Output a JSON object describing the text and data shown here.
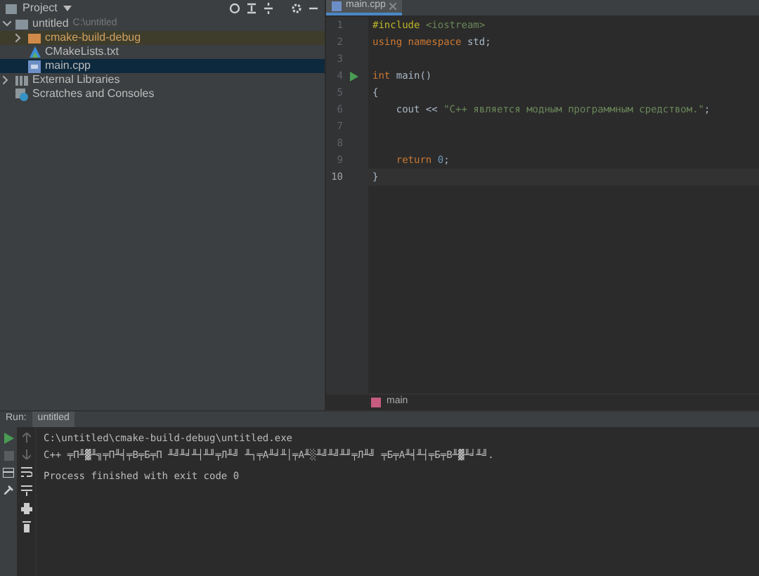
{
  "project_panel": {
    "title": "Project",
    "tree": [
      {
        "label": "untitled",
        "path": "C:\\untitled",
        "kind": "folder",
        "expanded": true,
        "selected": false,
        "children": [
          {
            "label": "cmake-build-debug",
            "kind": "excluded",
            "expanded": false,
            "selected": false
          },
          {
            "label": "CMakeLists.txt",
            "kind": "cmake",
            "selected": false
          },
          {
            "label": "main.cpp",
            "kind": "cpp",
            "selected": true
          }
        ]
      },
      {
        "label": "External Libraries",
        "kind": "libs",
        "expanded": false,
        "selected": false
      },
      {
        "label": "Scratches and Consoles",
        "kind": "scratch",
        "selected": false
      }
    ]
  },
  "editor": {
    "tabs": [
      {
        "label": "main.cpp",
        "selected": true
      }
    ],
    "lines": [
      {
        "number": "1",
        "current": false,
        "runnable": false,
        "tokens": [
          {
            "kind": "preproc",
            "text": "#include "
          },
          {
            "kind": "header",
            "text": "<iostream>"
          }
        ]
      },
      {
        "number": "2",
        "current": false,
        "runnable": false,
        "tokens": [
          {
            "kind": "keyword",
            "text": "using namespace "
          },
          {
            "kind": "plain",
            "text": "std;"
          }
        ]
      },
      {
        "number": "3",
        "current": false,
        "runnable": false
      },
      {
        "number": "4",
        "current": false,
        "runnable": true,
        "tokens": [
          {
            "kind": "keyword",
            "text": "int "
          },
          {
            "kind": "plain",
            "text": "main()"
          }
        ]
      },
      {
        "number": "5",
        "current": false,
        "runnable": false,
        "tokens": [
          {
            "kind": "plain",
            "text": "{"
          }
        ]
      },
      {
        "number": "6",
        "current": false,
        "runnable": false,
        "tokens": [
          {
            "kind": "plain",
            "text": "    cout << "
          },
          {
            "kind": "string",
            "text": "\"C++ является модным программным средством.\""
          },
          {
            "kind": "plain",
            "text": ";"
          }
        ]
      },
      {
        "number": "7",
        "current": false,
        "runnable": false
      },
      {
        "number": "8",
        "current": false,
        "runnable": false
      },
      {
        "number": "9",
        "current": false,
        "runnable": false,
        "tokens": [
          {
            "kind": "keyword",
            "text": "    return "
          },
          {
            "kind": "number",
            "text": "0"
          },
          {
            "kind": "plain",
            "text": ";"
          }
        ]
      },
      {
        "number": "10",
        "current": true,
        "runnable": false,
        "tokens": [
          {
            "kind": "plain",
            "text": "}"
          }
        ]
      }
    ],
    "breadcrumb": "main"
  },
  "run_panel": {
    "title": "Run:",
    "tabs": [
      {
        "label": "untitled",
        "selected": true
      }
    ],
    "output": [
      {
        "kind": "stdout",
        "text": "C:\\untitled\\cmake-build-debug\\untitled.exe"
      },
      {
        "kind": "stdout",
        "text": "C++ ╤П╨▓╨╗╤П╨╡╤В╤Б╤П ╨╝╨╛╨┤╨╜╤Л╨╝ ╨┐╤А╨╛╨│╤А╨░╨╝╨╝╨╜╤Л╨╝ ╤Б╤А╨╡╨┤╤Б╤В╨▓╨╛╨╝."
      },
      {
        "kind": "status",
        "text": "Process finished with exit code 0"
      }
    ]
  }
}
